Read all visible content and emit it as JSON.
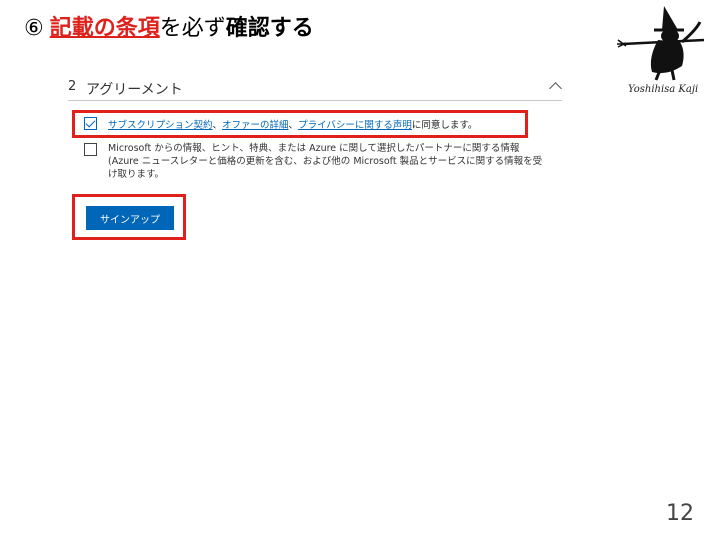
{
  "slide": {
    "title_number": "⑥",
    "title_red": "記載の条項",
    "title_mid": "を",
    "title_plain": "必ず",
    "title_end": "確認する",
    "page_number": "12",
    "logo_signature": "Yoshihisa Kaji",
    "highlight_color": "#e0201b"
  },
  "form": {
    "step_number": "2",
    "section_title": "アグリーメント",
    "agreement": {
      "checked": true,
      "link_subscription": "サブスクリプション契約",
      "sep1": "、",
      "link_offer": "オファーの詳細",
      "sep2": "、",
      "link_privacy": "プライバシーに関する声明",
      "suffix": "に同意します。"
    },
    "optin": {
      "checked": false,
      "text": "Microsoft からの情報、ヒント、特典、または Azure に関して選択したパートナーに関する情報 (Azure ニュースレターと価格の更新を含む、および他の Microsoft 製品とサービスに関する情報を受け取ります。"
    },
    "signup_label": "サインアップ",
    "accent_color": "#0067b8"
  }
}
